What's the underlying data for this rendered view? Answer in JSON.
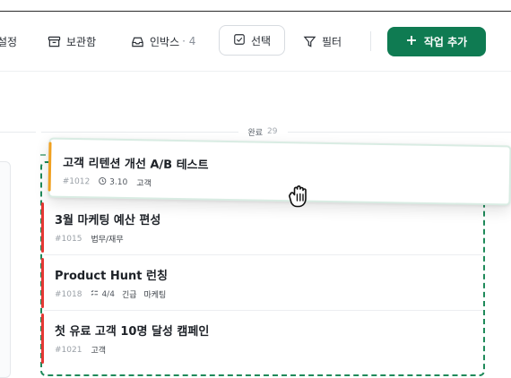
{
  "toolbar": {
    "cut_label": "설정",
    "archive_label": "보관함",
    "inbox_label": "인박스",
    "inbox_count": "· 4",
    "select_label": "선택",
    "filter_label": "필터",
    "add_label": "작업 추가"
  },
  "column": {
    "title": "완료",
    "count": "29"
  },
  "dragged_card": {
    "title": "고객 리텐션 개선 A/B 테스트",
    "id": "#1012",
    "due": "3.10",
    "tags": [
      "고객"
    ]
  },
  "cards": [
    {
      "title": "3월 마케팅 예산 편성",
      "id": "#1015",
      "subtasks": "",
      "tags": [
        "법무/재무"
      ]
    },
    {
      "title": "Product Hunt 런칭",
      "id": "#1018",
      "subtasks": "4/4",
      "tags": [
        "긴급",
        "마케팅"
      ]
    },
    {
      "title": "첫 유료 고객 10명 달성 캠페인",
      "id": "#1021",
      "subtasks": "",
      "tags": [
        "고객"
      ]
    }
  ],
  "colors": {
    "accent": "#0f7b52",
    "priority_high": "#e53935",
    "priority_medium": "#f0a020",
    "dropzone": "#1f8a5a"
  },
  "icons": [
    "archive-icon",
    "inbox-icon",
    "checkbox-icon",
    "filter-icon",
    "plus-icon",
    "clock-icon",
    "subtask-icon",
    "grab-hand-icon"
  ]
}
